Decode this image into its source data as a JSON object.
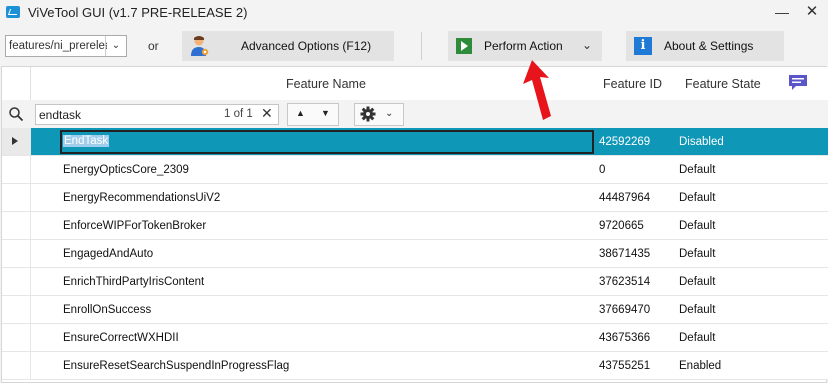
{
  "window": {
    "title": "ViVeTool GUI (v1.7 PRE-RELEASE 2)",
    "minimize_glyph": "—",
    "close_glyph": "✕"
  },
  "toolbar": {
    "branch_value": "features/ni_prerelease",
    "or_label": "or",
    "advanced_label": "Advanced Options (F12)",
    "perform_label": "Perform Action",
    "about_label": "About & Settings"
  },
  "grid": {
    "columns": {
      "name": "Feature Name",
      "id": "Feature ID",
      "state": "Feature State"
    },
    "search": {
      "value": "endtask",
      "count": "1 of 1"
    },
    "rows": [
      {
        "name": "EndTask",
        "id": "42592269",
        "state": "Disabled",
        "selected": true
      },
      {
        "name": "EnergyOpticsCore_2309",
        "id": "0",
        "state": "Default"
      },
      {
        "name": "EnergyRecommendationsUiV2",
        "id": "44487964",
        "state": "Default"
      },
      {
        "name": "EnforceWIPForTokenBroker",
        "id": "9720665",
        "state": "Default"
      },
      {
        "name": "EngagedAndAuto",
        "id": "38671435",
        "state": "Default"
      },
      {
        "name": "EnrichThirdPartyIrisContent",
        "id": "37623514",
        "state": "Default"
      },
      {
        "name": "EnrollOnSuccess",
        "id": "37669470",
        "state": "Default"
      },
      {
        "name": "EnsureCorrectWXHDII",
        "id": "43675366",
        "state": "Default"
      },
      {
        "name": "EnsureResetSearchSuspendInProgressFlag",
        "id": "43755251",
        "state": "Enabled"
      }
    ]
  },
  "colors": {
    "selection": "#0f97b8",
    "annotation_arrow": "#e8141c",
    "chat_icon": "#5a55c8"
  }
}
